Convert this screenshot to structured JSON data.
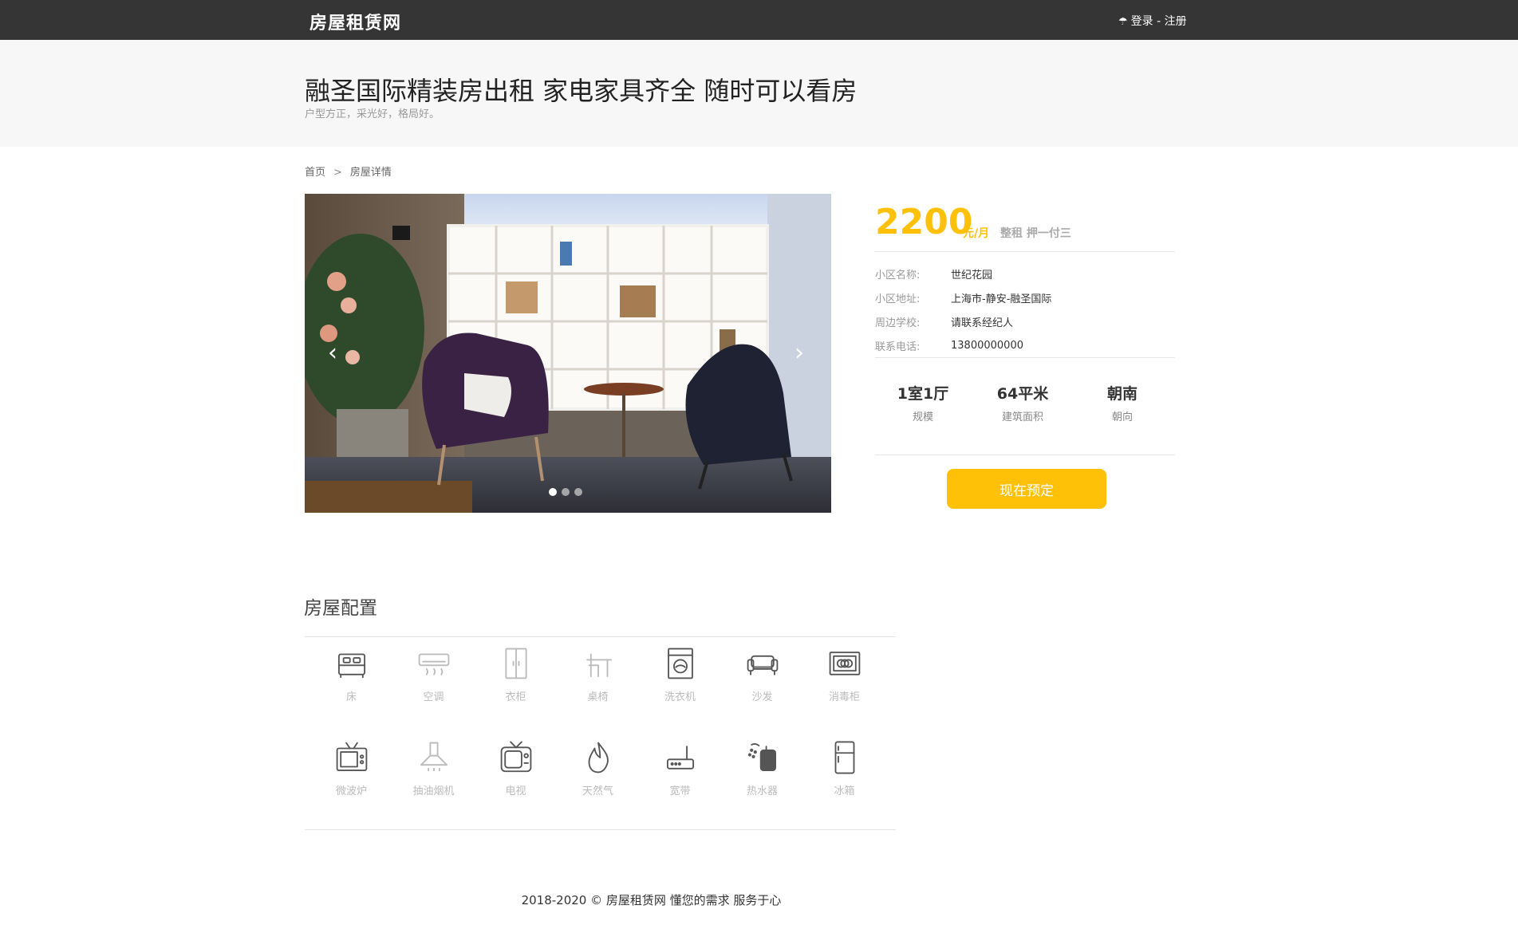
{
  "header": {
    "brand": "房屋租赁网",
    "auth_icon": "umbrella-icon",
    "login": "登录",
    "separator": " - ",
    "register": "注册"
  },
  "hero": {
    "title": "融圣国际精装房出租 家电家具齐全 随时可以看房",
    "subtitle": "户型方正，采光好，格局好。"
  },
  "breadcrumb": {
    "home": "首页",
    "sep": ">",
    "current": "房屋详情"
  },
  "carousel": {
    "prev_icon": "chevron-left-icon",
    "next_icon": "chevron-right-icon",
    "prev": "‹",
    "next": "›",
    "slide_count": 3,
    "active_index": 0
  },
  "listing": {
    "price": "2200",
    "unit": "元/月",
    "payment": "整租 押一付三",
    "details": [
      {
        "label": "小区名称:",
        "value": "世纪花园"
      },
      {
        "label": "小区地址:",
        "value": "上海市-静安-融圣国际"
      },
      {
        "label": "周边学校:",
        "value": "请联系经纪人"
      },
      {
        "label": "联系电话:",
        "value": "13800000000"
      }
    ],
    "stats": [
      {
        "value": "1室1厅",
        "label": "规模"
      },
      {
        "value": "64平米",
        "label": "建筑面积"
      },
      {
        "value": "朝南",
        "label": "朝向"
      }
    ],
    "book_label": "现在预定"
  },
  "config": {
    "title": "房屋配置",
    "items": [
      {
        "icon": "bed-icon",
        "label": "床",
        "available": true
      },
      {
        "icon": "air-conditioner-icon",
        "label": "空调",
        "available": false
      },
      {
        "icon": "wardrobe-icon",
        "label": "衣柜",
        "available": false
      },
      {
        "icon": "desk-chair-icon",
        "label": "桌椅",
        "available": false
      },
      {
        "icon": "washing-machine-icon",
        "label": "洗衣机",
        "available": true
      },
      {
        "icon": "sofa-icon",
        "label": "沙发",
        "available": true
      },
      {
        "icon": "sterilizer-cabinet-icon",
        "label": "消毒柜",
        "available": true
      },
      {
        "icon": "microwave-icon",
        "label": "微波炉",
        "available": true
      },
      {
        "icon": "range-hood-icon",
        "label": "抽油烟机",
        "available": false
      },
      {
        "icon": "tv-icon",
        "label": "电视",
        "available": true
      },
      {
        "icon": "gas-flame-icon",
        "label": "天然气",
        "available": true
      },
      {
        "icon": "router-icon",
        "label": "宽带",
        "available": true
      },
      {
        "icon": "water-heater-icon",
        "label": "热水器",
        "available": true
      },
      {
        "icon": "fridge-icon",
        "label": "冰箱",
        "available": true
      }
    ]
  },
  "footer": {
    "text": "2018-2020 © 房屋租赁网 懂您的需求 服务于心"
  },
  "colors": {
    "topbar": "#353535",
    "accent": "#ffc107",
    "hero_bg": "#f7f7f7",
    "icon_active": "#555555",
    "icon_inactive": "#bbbbbb"
  }
}
